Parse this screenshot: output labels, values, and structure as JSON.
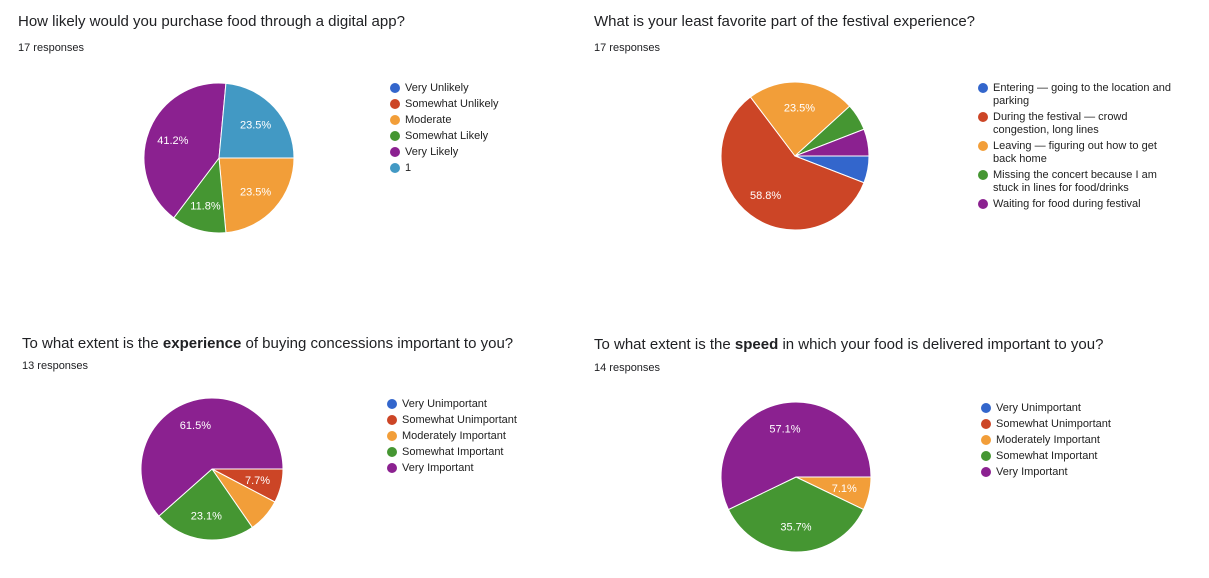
{
  "chart_data": [
    {
      "type": "pie",
      "title": "How likely would you purchase food through a digital app?",
      "title_parts": [
        {
          "text": "How likely would you purchase food through a digital app?",
          "bold": false
        }
      ],
      "subtitle": "17 responses",
      "legend_position": "right",
      "slices": [
        {
          "label": "Very Unlikely",
          "value": 0,
          "percent_label": "",
          "color": "#3366cc"
        },
        {
          "label": "Somewhat Unlikely",
          "value": 0,
          "percent_label": "",
          "color": "#cc4526"
        },
        {
          "label": "Moderate",
          "value": 4,
          "percent_label": "23.5%",
          "color": "#f29e39"
        },
        {
          "label": "Somewhat Likely",
          "value": 2,
          "percent_label": "11.8%",
          "color": "#459632"
        },
        {
          "label": "Very Likely",
          "value": 7,
          "percent_label": "41.2%",
          "color": "#8b2190"
        },
        {
          "label": "1",
          "value": 4,
          "percent_label": "23.5%",
          "color": "#4299c4"
        }
      ]
    },
    {
      "type": "pie",
      "title": "What is your least favorite part of the festival experience?",
      "title_parts": [
        {
          "text": "What is your least favorite part of the festival experience?",
          "bold": false
        }
      ],
      "subtitle": "17 responses",
      "legend_position": "right",
      "slices": [
        {
          "label": "Entering — going to the location and parking",
          "value": 1,
          "percent_label": "",
          "color": "#3366cc"
        },
        {
          "label": "During the festival — crowd congestion, long lines",
          "value": 10,
          "percent_label": "58.8%",
          "color": "#cc4526"
        },
        {
          "label": "Leaving — figuring out how to get back home",
          "value": 4,
          "percent_label": "23.5%",
          "color": "#f29e39"
        },
        {
          "label": "Missing the concert because I am stuck in lines for food/drinks",
          "value": 1,
          "percent_label": "",
          "color": "#459632"
        },
        {
          "label": "Waiting for food during festival",
          "value": 1,
          "percent_label": "",
          "color": "#8b2190"
        }
      ]
    },
    {
      "type": "pie",
      "title": "To what extent is the experience of buying concessions important to you?",
      "title_parts": [
        {
          "text": "To what extent is the ",
          "bold": false
        },
        {
          "text": "experience",
          "bold": true
        },
        {
          "text": " of buying concessions important to you?",
          "bold": false
        }
      ],
      "subtitle": "13 responses",
      "legend_position": "right",
      "slices": [
        {
          "label": "Very Unimportant",
          "value": 0,
          "percent_label": "",
          "color": "#3366cc"
        },
        {
          "label": "Somewhat Unimportant",
          "value": 1,
          "percent_label": "7.7%",
          "color": "#cc4526"
        },
        {
          "label": "Moderately Important",
          "value": 1,
          "percent_label": "",
          "color": "#f29e39"
        },
        {
          "label": "Somewhat Important",
          "value": 3,
          "percent_label": "23.1%",
          "color": "#459632"
        },
        {
          "label": "Very Important",
          "value": 8,
          "percent_label": "61.5%",
          "color": "#8b2190"
        }
      ]
    },
    {
      "type": "pie",
      "title": "To what extent is the speed in which your food is delivered important to you?",
      "title_parts": [
        {
          "text": "To what extent is the ",
          "bold": false
        },
        {
          "text": "speed",
          "bold": true
        },
        {
          "text": " in which your food is delivered important to you?",
          "bold": false
        }
      ],
      "subtitle": "14 responses",
      "legend_position": "right",
      "slices": [
        {
          "label": "Very Unimportant",
          "value": 0,
          "percent_label": "",
          "color": "#3366cc"
        },
        {
          "label": "Somewhat Unimportant",
          "value": 0,
          "percent_label": "",
          "color": "#cc4526"
        },
        {
          "label": "Moderately Important",
          "value": 1,
          "percent_label": "7.1%",
          "color": "#f29e39"
        },
        {
          "label": "Somewhat Important",
          "value": 5,
          "percent_label": "35.7%",
          "color": "#459632"
        },
        {
          "label": "Very Important",
          "value": 8,
          "percent_label": "57.1%",
          "color": "#8b2190"
        }
      ]
    }
  ]
}
